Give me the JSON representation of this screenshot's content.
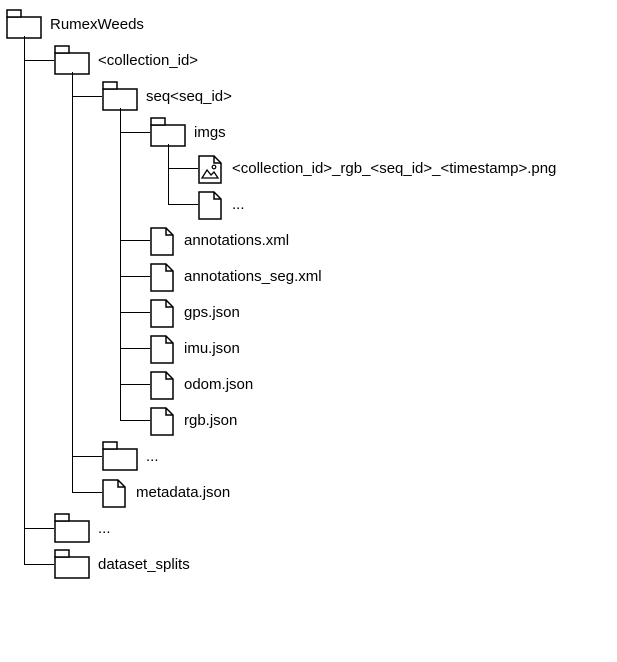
{
  "tree": {
    "root": "RumexWeeds",
    "collection": "<collection_id>",
    "seq": "seq<seq_id>",
    "imgs": "imgs",
    "img_file": "<collection_id>_rgb_<seq_id>_<timestamp>.png",
    "img_more": "...",
    "annotations_xml": "annotations.xml",
    "annotations_seg_xml": "annotations_seg.xml",
    "gps_json": "gps.json",
    "imu_json": "imu.json",
    "odom_json": "odom.json",
    "rgb_json": "rgb.json",
    "seq_more": "...",
    "metadata_json": "metadata.json",
    "root_more": "...",
    "dataset_splits": "dataset_splits"
  }
}
